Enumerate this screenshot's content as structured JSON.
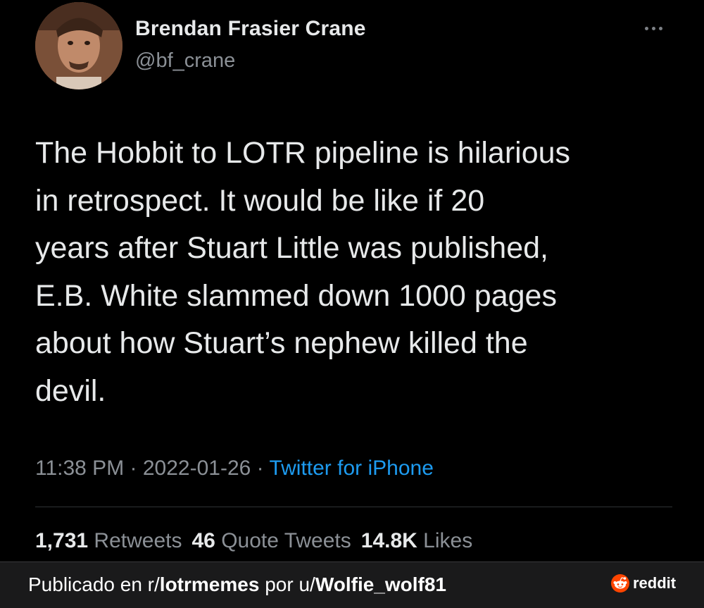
{
  "tweet": {
    "author": {
      "display_name": "Brendan Frasier Crane",
      "handle": "@bf_crane",
      "avatar_icon": "profile-photo"
    },
    "text": "The Hobbit to LOTR pipeline is hilarious\nin retrospect. It would be like if 20\nyears after Stuart Little was published,\nE.B. White slammed down 1000 pages\nabout how Stuart’s nephew killed the\ndevil.",
    "meta": {
      "time": "11:38 PM",
      "separator1": " · ",
      "date": "2022-01-26",
      "separator2": " · ",
      "source": "Twitter for iPhone"
    },
    "stats": {
      "retweets_count": "1,731",
      "retweets_label": "Retweets",
      "quotes_count": "46",
      "quotes_label": "Quote Tweets",
      "likes_count": "14.8K",
      "likes_label": "Likes"
    },
    "more_icon": "ellipsis-icon"
  },
  "footer": {
    "prefix": "Publicado en r/",
    "subreddit": "lotrmemes",
    "middle": " por u/",
    "username": "Wolfie_wolf81",
    "brand": "reddit",
    "brand_color": "#ff4500"
  },
  "colors": {
    "background": "#000000",
    "text": "#e7e9ea",
    "muted": "#8b9096",
    "link": "#1d9bf0",
    "footer_bg": "#1a1a1b"
  }
}
